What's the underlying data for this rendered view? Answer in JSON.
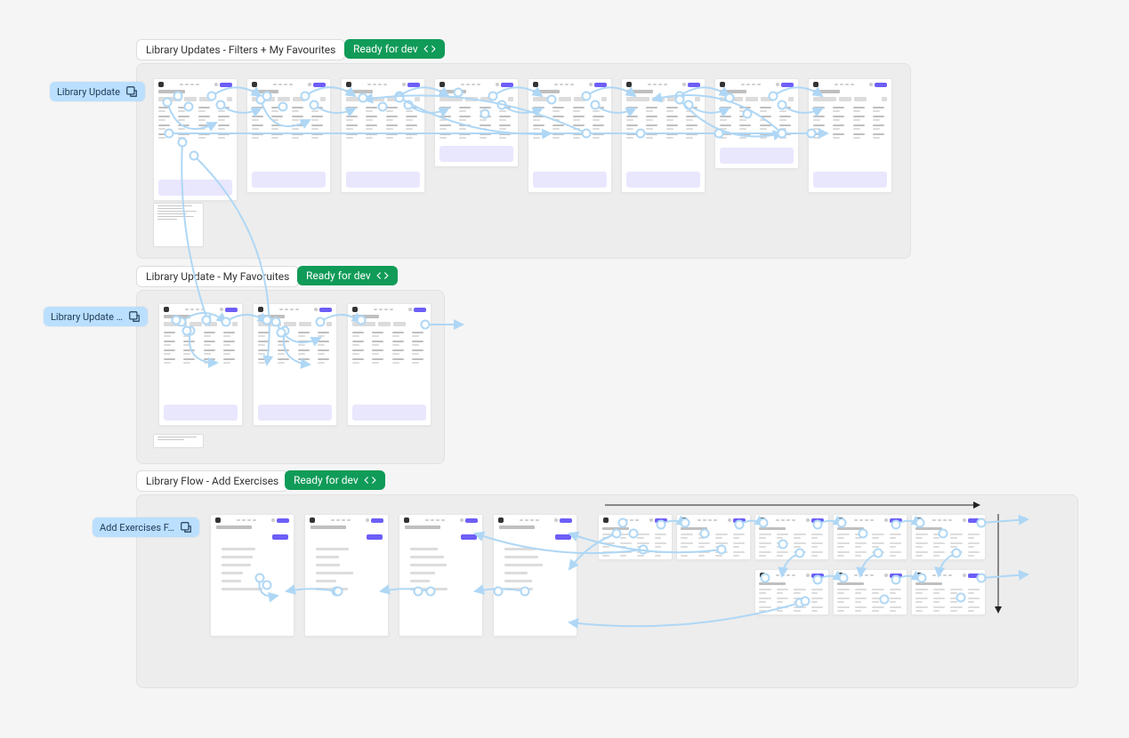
{
  "sections": {
    "s1": {
      "title": "Library Updates - Filters + My Favourites",
      "status": "Ready for dev"
    },
    "s2": {
      "title": "Library Update - My Favoruites",
      "status": "Ready for dev"
    },
    "s3": {
      "title": "Library Flow - Add Exercises",
      "status": "Ready for dev"
    }
  },
  "flowLabels": {
    "f1": "Library Update",
    "f2": "Library Update …",
    "f3": "Add Exercises F…"
  },
  "colors": {
    "status": "#109B58",
    "flowLabelBg": "#BADFFF",
    "accent": "#6D5EF7",
    "connector": "#AFD7F5"
  }
}
